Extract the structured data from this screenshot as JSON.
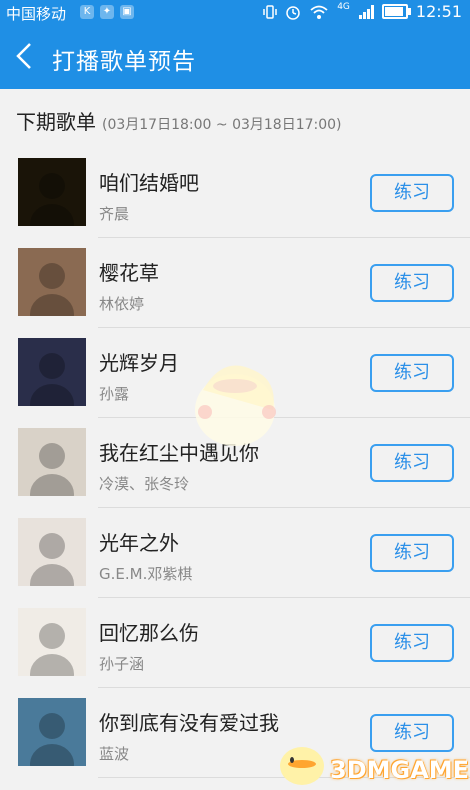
{
  "status_bar": {
    "carrier": "中国移动",
    "network": "4G",
    "time": "12:51",
    "battery_level": 0.9
  },
  "header": {
    "back_icon": "chevron-left-icon",
    "title": "打播歌单预告"
  },
  "section": {
    "title": "下期歌单",
    "range": "(03月17日18:00 ~ 03月18日17:00)"
  },
  "songs": [
    {
      "title": "咱们结婚吧",
      "artist": "齐晨",
      "button": "练习",
      "cover_color": "#1a1408"
    },
    {
      "title": "樱花草",
      "artist": "林依婷",
      "button": "练习",
      "cover_color": "#8a6a52"
    },
    {
      "title": "光辉岁月",
      "artist": "孙露",
      "button": "练习",
      "cover_color": "#2a2e4a"
    },
    {
      "title": "我在红尘中遇见你",
      "artist": "冷漠、张冬玲",
      "button": "练习",
      "cover_color": "#d9d2c8"
    },
    {
      "title": "光年之外",
      "artist": "G.E.M.邓紫棋",
      "button": "练习",
      "cover_color": "#e8e2dc"
    },
    {
      "title": "回忆那么伤",
      "artist": "孙子涵",
      "button": "练习",
      "cover_color": "#f0ece6"
    },
    {
      "title": "你到底有没有爱过我",
      "artist": "蓝波",
      "button": "练习",
      "cover_color": "#4a7a9a"
    }
  ],
  "watermark": {
    "text": "3DMGAME"
  },
  "colors": {
    "primary": "#1f8fe5",
    "button_border": "#3a9ff0",
    "background": "#f2f2f2"
  }
}
